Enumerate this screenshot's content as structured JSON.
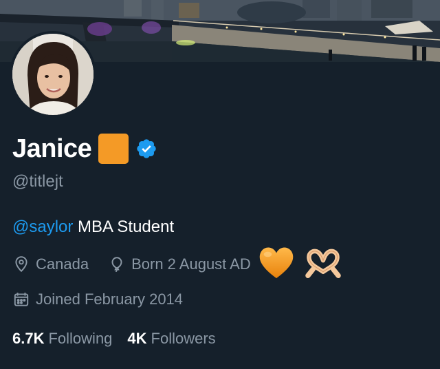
{
  "profile": {
    "display_name": "Janice",
    "handle": "@titlejt",
    "bio_mention": "@saylor",
    "bio_text": " MBA Student",
    "location": "Canada",
    "birthday": "Born 2 August AD",
    "joined": "Joined February 2014"
  },
  "stats": {
    "following_count": "6.7K",
    "following_label": "Following",
    "followers_count": "4K",
    "followers_label": "Followers"
  },
  "icons": {
    "name_badge": "orange-square-emoji",
    "verified": "verified-badge-icon",
    "location": "location-pin-icon",
    "birthday": "balloon-icon",
    "joined": "calendar-icon",
    "birthday_emoji_1": "orange-heart-emoji",
    "birthday_emoji_2": "heart-hands-emoji"
  },
  "colors": {
    "background": "#15202b",
    "accent": "#1d9bf0",
    "secondary_text": "#8b98a5",
    "orange": "#f49a26"
  }
}
